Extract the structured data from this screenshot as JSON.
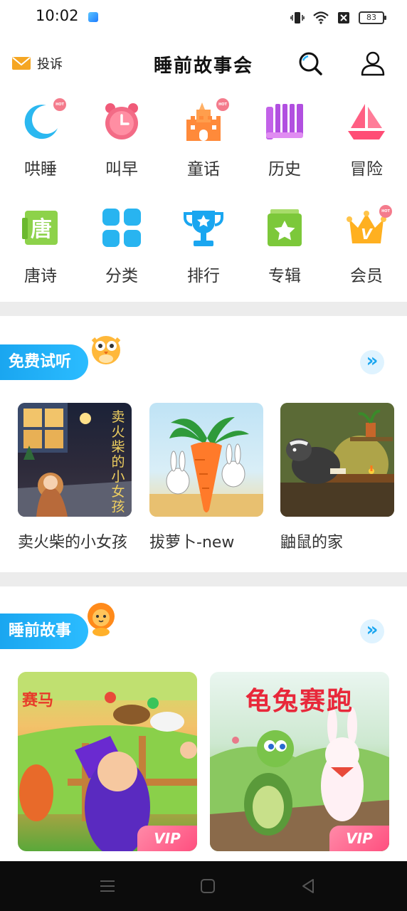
{
  "status": {
    "time": "10:02",
    "battery": "83"
  },
  "header": {
    "complain_label": "投诉",
    "title": "睡前故事会"
  },
  "grid": [
    {
      "label": "哄睡",
      "icon": "moon-sleep-icon",
      "hot": true,
      "hot_text": "HOT"
    },
    {
      "label": "叫早",
      "icon": "alarm-clock-icon",
      "hot": false
    },
    {
      "label": "童话",
      "icon": "castle-icon",
      "hot": true,
      "hot_text": "HOT"
    },
    {
      "label": "历史",
      "icon": "history-bars-icon",
      "hot": false
    },
    {
      "label": "冒险",
      "icon": "sailboat-icon",
      "hot": false
    },
    {
      "label": "唐诗",
      "icon": "tang-poem-icon",
      "hot": false,
      "glyph": "唐"
    },
    {
      "label": "分类",
      "icon": "category-grid-icon",
      "hot": false
    },
    {
      "label": "排行",
      "icon": "trophy-icon",
      "hot": false
    },
    {
      "label": "专辑",
      "icon": "album-star-icon",
      "hot": false
    },
    {
      "label": "会员",
      "icon": "vip-crown-icon",
      "hot": true,
      "hot_text": "HOT",
      "glyph": "V"
    }
  ],
  "free_section": {
    "title": "免费试听",
    "cards": [
      {
        "title": "卖火柴的小女孩",
        "image": "match-girl-illustration",
        "overlay_text": "卖火柴的小女孩"
      },
      {
        "title": "拔萝卜-new",
        "image": "carrot-rabbits-illustration"
      },
      {
        "title": "鼬鼠的家",
        "image": "badger-home-illustration"
      }
    ]
  },
  "bedtime_section": {
    "title": "睡前故事",
    "cards": [
      {
        "image": "horse-race-illustration",
        "overlay_text": "赛马",
        "badge": "VIP"
      },
      {
        "image": "tortoise-hare-illustration",
        "overlay_text": "龟兔赛跑",
        "badge": "VIP"
      }
    ]
  },
  "colors": {
    "accent": "#1aa6f0",
    "vip": "#ff4f7f",
    "divider": "#ececec"
  }
}
